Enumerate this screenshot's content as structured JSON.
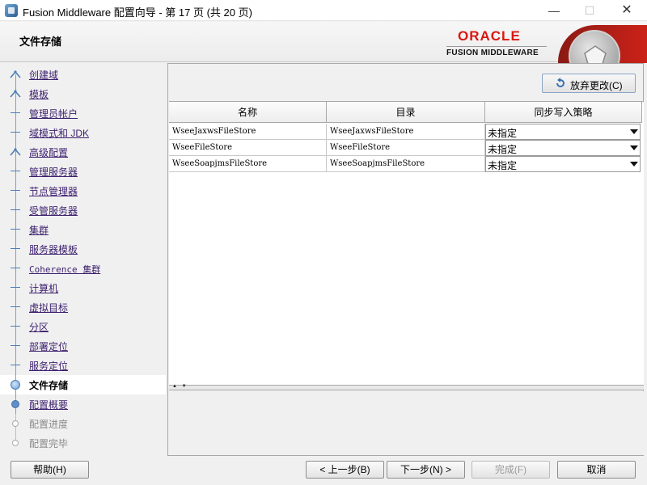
{
  "window": {
    "title": "Fusion Middleware 配置向导 - 第 17 页 (共 20 页)",
    "min_glyph": "—",
    "max_glyph": "☐",
    "close_glyph": "✕"
  },
  "header": {
    "page_title": "文件存储",
    "brand_oracle": "ORACLE",
    "brand_fusion": "FUSION MIDDLEWARE"
  },
  "sidebar": {
    "items": [
      {
        "label": "创建域",
        "state": "done-person"
      },
      {
        "label": "模板",
        "state": "done-person"
      },
      {
        "label": "管理员帐户",
        "state": "done"
      },
      {
        "label": "域模式和 JDK",
        "state": "done"
      },
      {
        "label": "高级配置",
        "state": "done-person"
      },
      {
        "label": "管理服务器",
        "state": "done"
      },
      {
        "label": "节点管理器",
        "state": "done"
      },
      {
        "label": "受管服务器",
        "state": "done"
      },
      {
        "label": "集群",
        "state": "done"
      },
      {
        "label": "服务器模板",
        "state": "done"
      },
      {
        "label": "Coherence 集群",
        "state": "done"
      },
      {
        "label": "计算机",
        "state": "done"
      },
      {
        "label": "虚拟目标",
        "state": "done"
      },
      {
        "label": "分区",
        "state": "done"
      },
      {
        "label": "部署定位",
        "state": "done"
      },
      {
        "label": "服务定位",
        "state": "done"
      },
      {
        "label": "文件存储",
        "state": "current"
      },
      {
        "label": "配置概要",
        "state": "next"
      },
      {
        "label": "配置进度",
        "state": "disabled"
      },
      {
        "label": "配置完毕",
        "state": "disabled"
      }
    ]
  },
  "toolbar": {
    "discard_label": "放弃更改(C)"
  },
  "table": {
    "columns": [
      "名称",
      "目录",
      "同步写入策略"
    ],
    "rows": [
      {
        "name": "WseeJaxwsFileStore",
        "directory": "WseeJaxwsFileStore",
        "policy": "未指定"
      },
      {
        "name": "WseeFileStore",
        "directory": "WseeFileStore",
        "policy": "未指定"
      },
      {
        "name": "WseeSoapjmsFileStore",
        "directory": "WseeSoapjmsFileStore",
        "policy": "未指定"
      }
    ]
  },
  "splitter": {
    "arrows": "▲ ▼"
  },
  "footer": {
    "help": "帮助(H)",
    "back": "< 上一步(B)",
    "next": "下一步(N) >",
    "finish": "完成(F)",
    "cancel": "取消"
  },
  "colors": {
    "oracle_red": "#d8180f",
    "link_purple": "#3c1f6e",
    "progress_blue": "#4d7fb6"
  }
}
